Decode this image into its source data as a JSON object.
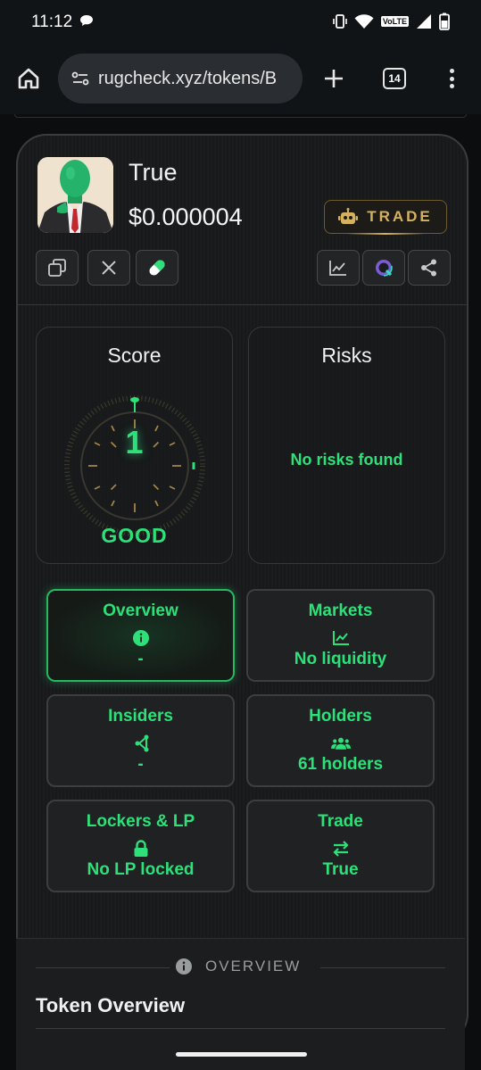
{
  "status_bar": {
    "time": "11:12",
    "network_badge": "VoLTE"
  },
  "browser": {
    "url": "rugcheck.xyz/tokens/B",
    "tab_count": "14"
  },
  "token": {
    "name": "True",
    "price": "$0.000004",
    "trade_label": "TRADE"
  },
  "score_panel": {
    "title": "Score",
    "value": "1",
    "rating": "GOOD"
  },
  "risks_panel": {
    "title": "Risks",
    "message": "No risks found"
  },
  "tiles": [
    {
      "title": "Overview",
      "icon": "info-icon",
      "value": "-"
    },
    {
      "title": "Markets",
      "icon": "chart-line-icon",
      "value": "No liquidity"
    },
    {
      "title": "Insiders",
      "icon": "network-icon",
      "value": "-"
    },
    {
      "title": "Holders",
      "icon": "users-icon",
      "value": "61 holders"
    },
    {
      "title": "Lockers & LP",
      "icon": "lock-icon",
      "value": "No LP locked"
    },
    {
      "title": "Trade",
      "icon": "swap-arrows-icon",
      "value": "True"
    }
  ],
  "overview_section": {
    "label": "OVERVIEW",
    "heading": "Token Overview"
  },
  "colors": {
    "accent_green": "#2ee07a",
    "trade_gold": "#d6b25e",
    "background": "#0c0d0e"
  }
}
